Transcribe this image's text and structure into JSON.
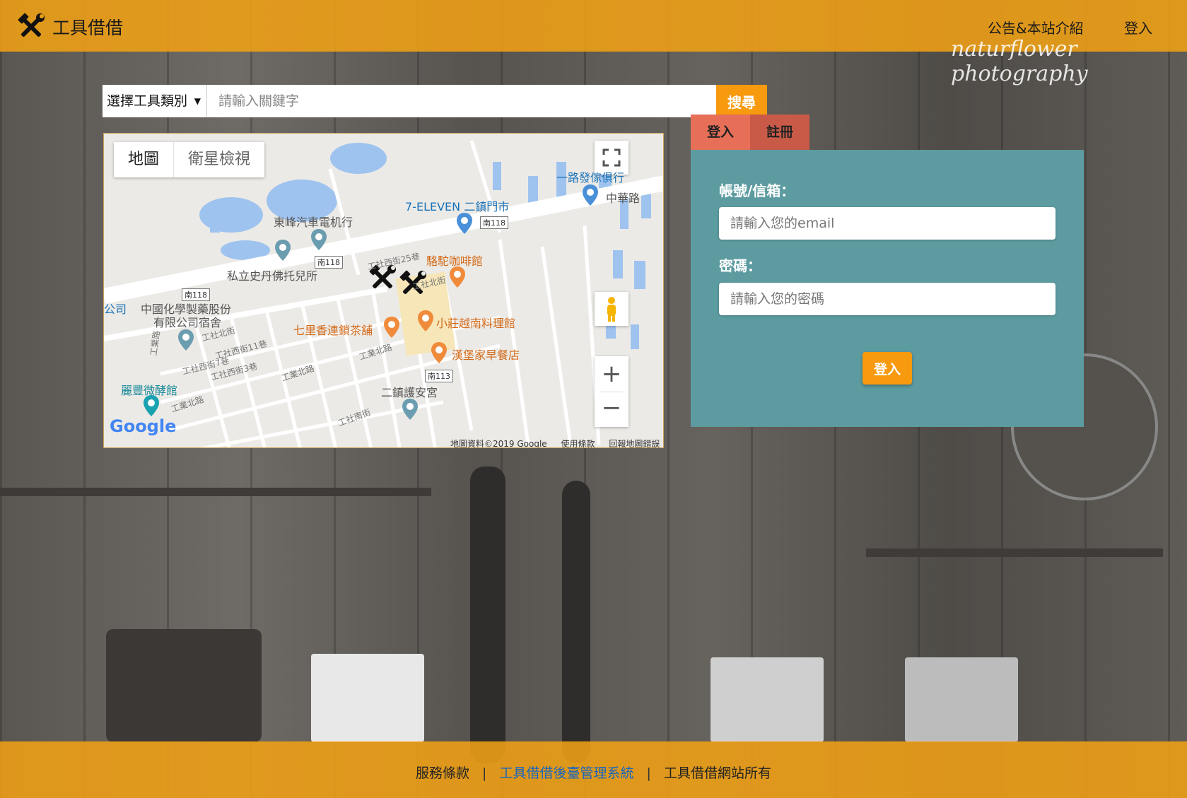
{
  "header": {
    "title": "工具借借",
    "nav_about": "公告&本站介紹",
    "nav_login": "登入",
    "logo_icon": "hammer-wrench-icon",
    "watermark": "naturflower photography"
  },
  "search": {
    "category_label": "選擇工具類別",
    "keyword_placeholder": "請輸入關鍵字",
    "button_label": "搜尋"
  },
  "map": {
    "type_map": "地圖",
    "type_satellite": "衛星檢視",
    "attribution": "地圖資料©2019 Google",
    "terms": "使用條款",
    "report": "回報地圖錯誤",
    "google_logo": "Google",
    "places": [
      {
        "name": "一路發傢俱行",
        "kind": "shop"
      },
      {
        "name": "中華路",
        "kind": "street"
      },
      {
        "name": "7-ELEVEN 二鎮門市",
        "kind": "shop"
      },
      {
        "name": "東峰汽車電机行",
        "kind": "place"
      },
      {
        "name": "私立史丹佛托兒所",
        "kind": "place"
      },
      {
        "name": "駱駝咖啡館",
        "kind": "food"
      },
      {
        "name": "中國化學製藥股份",
        "kind": "place"
      },
      {
        "name": "有限公司宿舍",
        "kind": "place"
      },
      {
        "name": "七里香連鎖茶舖",
        "kind": "food"
      },
      {
        "name": "小莊越南料理館",
        "kind": "food"
      },
      {
        "name": "漢堡家早餐店",
        "kind": "food"
      },
      {
        "name": "麗豐微酵館",
        "kind": "attraction"
      },
      {
        "name": "二鎮護安宮",
        "kind": "temple"
      },
      {
        "name": "公司",
        "kind": "place"
      }
    ],
    "road_signs": [
      "南118",
      "南118",
      "南118",
      "南113"
    ],
    "streets": [
      "工社西街25巷",
      "工社北街",
      "工社西街11巷",
      "工社西街7巷",
      "工社西街3巷",
      "工業北路",
      "工業北路",
      "工業北路",
      "工社南街",
      "工業路",
      "工社北街"
    ]
  },
  "login": {
    "tab_login": "登入",
    "tab_register": "註冊",
    "account_label": "帳號/信箱：",
    "account_placeholder": "請輸入您的email",
    "password_label": "密碼：",
    "password_placeholder": "請輸入您的密碼",
    "submit_label": "登入"
  },
  "footer": {
    "terms": "服務條款",
    "separator": "|",
    "admin": "工具借借後臺管理系統",
    "rights": "工具借借網站所有"
  }
}
